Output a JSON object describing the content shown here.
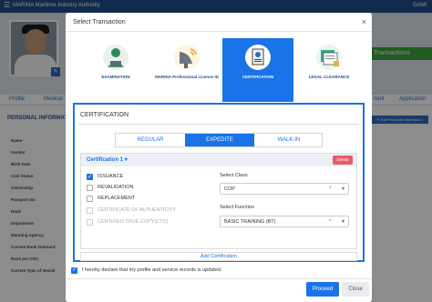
{
  "app": {
    "menu_icon": "☰",
    "brand": "MARINA Maritime Industry Authority",
    "user": "DAMI"
  },
  "profile": {
    "avatar_edit_icon": "✎",
    "transactions_button": "Transactions",
    "tabs": [
      "Profile",
      "Medical",
      "nent",
      "Application"
    ],
    "section_title": "PERSONAL INFORMATI",
    "edit_button": "✎ Edit Personal Information",
    "fields": [
      "Name",
      "Gender",
      "Birth Date",
      "Civil Status",
      "Citizenship",
      "Passport No",
      "Rank",
      "Department",
      "Manning Agency",
      "Current Rank Onboard",
      "Rank per COC",
      "Current Type of Vessel"
    ]
  },
  "modal": {
    "title": "Select Transaction",
    "close_icon": "×",
    "transaction_types": [
      {
        "label": "EXAMINATION",
        "icon": "person-with-laptop-icon",
        "active": false
      },
      {
        "label": "MARINA Professional License ID",
        "icon": "satellite-dish-icon",
        "active": false
      },
      {
        "label": "CERTIFICATION",
        "icon": "certificate-icon",
        "active": true
      },
      {
        "label": "LEGAL CLEARANCE",
        "icon": "documents-icon",
        "active": false
      }
    ],
    "panel_title": "CERTIFICATION",
    "modes": [
      "REGULAR",
      "EXPEDITE",
      "WALK-IN"
    ],
    "active_mode": "EXPEDITE",
    "certification": {
      "name": "Certification 1",
      "caret": "▾",
      "delete_label": "Delete",
      "options": [
        {
          "label": "ISSUANCE",
          "checked": true,
          "disabled": false
        },
        {
          "label": "REVALIDATION",
          "checked": false,
          "disabled": false
        },
        {
          "label": "REPLACEMENT",
          "checked": false,
          "disabled": false
        },
        {
          "label": "CERTIFICATE OF AUTHENTICITY",
          "checked": false,
          "disabled": true
        },
        {
          "label": "CERTIFIED TRUE COPY(CTC)",
          "checked": false,
          "disabled": true
        }
      ],
      "check_mark": "✓",
      "class_label": "Select Class",
      "class_value": "COP",
      "function_label": "Select Function",
      "function_value": "BASIC TRAINING (BT)",
      "clear_icon": "×",
      "dropdown_icon": "▾"
    },
    "add_certification": "Add Certification",
    "declaration": "I hereby declare that my profile and service records is updated.",
    "declaration_checked": true,
    "proceed_label": "Proceed",
    "close_label": "Close"
  },
  "colors": {
    "primary": "#1a73e8",
    "header": "#1f4e8a",
    "success": "#3ca63c",
    "danger": "#e35d6a"
  }
}
